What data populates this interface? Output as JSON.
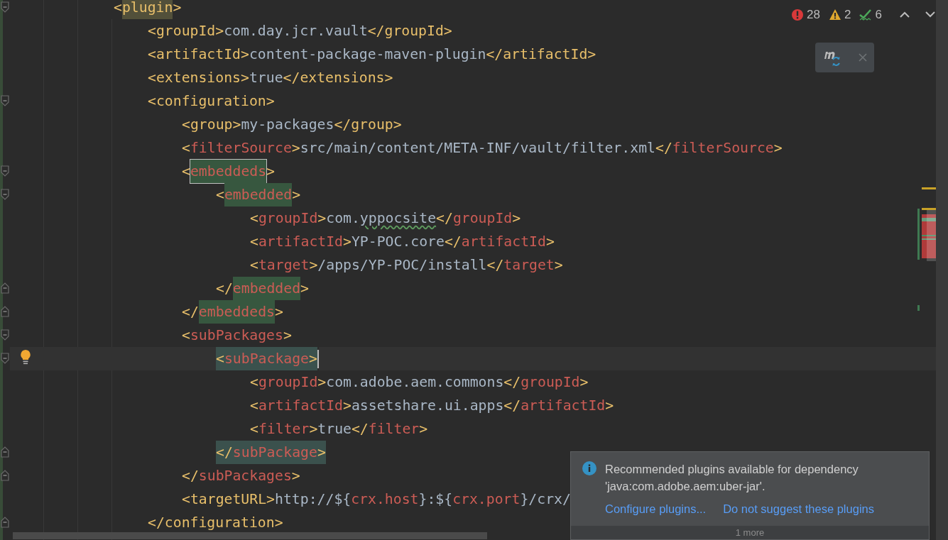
{
  "code": [
    {
      "line": {
        "tokens": [
          {
            "text": "<",
            "kind": "tag"
          },
          {
            "text": "plugin",
            "kind": "tag",
            "usage_highlight": true
          },
          {
            "text": ">",
            "kind": "tag"
          }
        ]
      },
      "children": [
        {
          "line": {
            "tokens": [
              {
                "text": "<groupId>",
                "kind": "tag"
              },
              {
                "text": "com.day.jcr.vault",
                "kind": "text"
              },
              {
                "text": "</groupId>",
                "kind": "tag"
              }
            ]
          }
        },
        {
          "line": {
            "tokens": [
              {
                "text": "<artifactId>",
                "kind": "tag"
              },
              {
                "text": "content-package-maven-plugin",
                "kind": "text"
              },
              {
                "text": "</artifactId>",
                "kind": "tag"
              }
            ]
          }
        },
        {
          "line": {
            "tokens": [
              {
                "text": "<extensions>",
                "kind": "tag"
              },
              {
                "text": "true",
                "kind": "text"
              },
              {
                "text": "</extensions>",
                "kind": "tag"
              }
            ]
          }
        },
        {
          "line": {
            "tokens": [
              {
                "text": "<configuration>",
                "kind": "tag"
              }
            ]
          },
          "children": [
            {
              "line": {
                "tokens": [
                  {
                    "text": "<group>",
                    "kind": "tag"
                  },
                  {
                    "text": "my-packages",
                    "kind": "text"
                  },
                  {
                    "text": "</group>",
                    "kind": "tag"
                  }
                ]
              }
            },
            {
              "line": {
                "tokens": [
                  {
                    "text": "<",
                    "kind": "tag"
                  },
                  {
                    "text": "filterSource",
                    "kind": "unknown"
                  },
                  {
                    "text": ">",
                    "kind": "tag"
                  },
                  {
                    "text": "src/main/content/META-INF/vault/filter.xml",
                    "kind": "text"
                  },
                  {
                    "text": "</",
                    "kind": "tag"
                  },
                  {
                    "text": "filterSource",
                    "kind": "unknown"
                  },
                  {
                    "text": ">",
                    "kind": "tag"
                  }
                ]
              }
            },
            {
              "line": {
                "tokens": [
                  {
                    "text": "<",
                    "kind": "tag"
                  },
                  {
                    "text": "embeddeds",
                    "kind": "unknown",
                    "brace_match": true,
                    "outlined": true
                  },
                  {
                    "text": ">",
                    "kind": "tag"
                  }
                ]
              },
              "children": [
                {
                  "line": {
                    "tokens": [
                      {
                        "text": "<",
                        "kind": "tag"
                      },
                      {
                        "text": "embedded",
                        "kind": "unknown",
                        "brace_match": true
                      },
                      {
                        "text": ">",
                        "kind": "tag"
                      }
                    ]
                  },
                  "children": [
                    {
                      "line": {
                        "tokens": [
                          {
                            "text": "<",
                            "kind": "tag"
                          },
                          {
                            "text": "groupId",
                            "kind": "unknown"
                          },
                          {
                            "text": ">",
                            "kind": "tag"
                          },
                          {
                            "text": "com.",
                            "kind": "text"
                          },
                          {
                            "text": "yppocsite",
                            "kind": "typo"
                          },
                          {
                            "text": "</",
                            "kind": "tag"
                          },
                          {
                            "text": "groupId",
                            "kind": "unknown"
                          },
                          {
                            "text": ">",
                            "kind": "tag"
                          }
                        ]
                      }
                    },
                    {
                      "line": {
                        "tokens": [
                          {
                            "text": "<",
                            "kind": "tag"
                          },
                          {
                            "text": "artifactId",
                            "kind": "unknown"
                          },
                          {
                            "text": ">",
                            "kind": "tag"
                          },
                          {
                            "text": "YP-POC.core",
                            "kind": "text"
                          },
                          {
                            "text": "</",
                            "kind": "tag"
                          },
                          {
                            "text": "artifactId",
                            "kind": "unknown"
                          },
                          {
                            "text": ">",
                            "kind": "tag"
                          }
                        ]
                      }
                    },
                    {
                      "line": {
                        "tokens": [
                          {
                            "text": "<",
                            "kind": "tag"
                          },
                          {
                            "text": "target",
                            "kind": "unknown"
                          },
                          {
                            "text": ">",
                            "kind": "tag"
                          },
                          {
                            "text": "/apps/YP-POC/install",
                            "kind": "text"
                          },
                          {
                            "text": "</",
                            "kind": "tag"
                          },
                          {
                            "text": "target",
                            "kind": "unknown"
                          },
                          {
                            "text": ">",
                            "kind": "tag"
                          }
                        ]
                      }
                    }
                  ],
                  "end": {
                    "tokens": [
                      {
                        "text": "</",
                        "kind": "tag"
                      },
                      {
                        "text": "embedded",
                        "kind": "unknown",
                        "brace_match": true
                      },
                      {
                        "text": ">",
                        "kind": "tag"
                      }
                    ]
                  }
                }
              ],
              "end": {
                "tokens": [
                  {
                    "text": "</",
                    "kind": "tag"
                  },
                  {
                    "text": "embeddeds",
                    "kind": "unknown",
                    "brace_match": true
                  },
                  {
                    "text": ">",
                    "kind": "tag"
                  }
                ]
              }
            },
            {
              "line": {
                "tokens": [
                  {
                    "text": "<",
                    "kind": "tag"
                  },
                  {
                    "text": "subPackages",
                    "kind": "unknown"
                  },
                  {
                    "text": ">",
                    "kind": "tag"
                  }
                ]
              },
              "children": [
                {
                  "line": {
                    "current": true,
                    "intention": true,
                    "caret": true,
                    "tokens": [
                      {
                        "text": "<",
                        "kind": "tag",
                        "pair_highlight": true
                      },
                      {
                        "text": "subPackage",
                        "kind": "unknown",
                        "pair_highlight": true
                      },
                      {
                        "text": ">",
                        "kind": "tag",
                        "pair_highlight": true
                      }
                    ]
                  },
                  "children": [
                    {
                      "line": {
                        "tokens": [
                          {
                            "text": "<",
                            "kind": "tag"
                          },
                          {
                            "text": "groupId",
                            "kind": "unknown"
                          },
                          {
                            "text": ">",
                            "kind": "tag"
                          },
                          {
                            "text": "com.adobe.aem.commons",
                            "kind": "text"
                          },
                          {
                            "text": "</",
                            "kind": "tag"
                          },
                          {
                            "text": "groupId",
                            "kind": "unknown"
                          },
                          {
                            "text": ">",
                            "kind": "tag"
                          }
                        ]
                      }
                    },
                    {
                      "line": {
                        "tokens": [
                          {
                            "text": "<",
                            "kind": "tag"
                          },
                          {
                            "text": "artifactId",
                            "kind": "unknown"
                          },
                          {
                            "text": ">",
                            "kind": "tag"
                          },
                          {
                            "text": "assetshare.ui.apps",
                            "kind": "text"
                          },
                          {
                            "text": "</",
                            "kind": "tag"
                          },
                          {
                            "text": "artifactId",
                            "kind": "unknown"
                          },
                          {
                            "text": ">",
                            "kind": "tag"
                          }
                        ]
                      }
                    },
                    {
                      "line": {
                        "tokens": [
                          {
                            "text": "<",
                            "kind": "tag"
                          },
                          {
                            "text": "filter",
                            "kind": "unknown"
                          },
                          {
                            "text": ">",
                            "kind": "tag"
                          },
                          {
                            "text": "true",
                            "kind": "text"
                          },
                          {
                            "text": "</",
                            "kind": "tag"
                          },
                          {
                            "text": "filter",
                            "kind": "unknown"
                          },
                          {
                            "text": ">",
                            "kind": "tag"
                          }
                        ]
                      }
                    }
                  ],
                  "end": {
                    "tokens": [
                      {
                        "text": "</",
                        "kind": "tag",
                        "pair_highlight": true
                      },
                      {
                        "text": "subPackage",
                        "kind": "unknown",
                        "pair_highlight": true
                      },
                      {
                        "text": ">",
                        "kind": "tag",
                        "pair_highlight": true
                      }
                    ]
                  }
                }
              ],
              "end": {
                "tokens": [
                  {
                    "text": "</",
                    "kind": "tag"
                  },
                  {
                    "text": "subPackages",
                    "kind": "unknown"
                  },
                  {
                    "text": ">",
                    "kind": "tag"
                  }
                ]
              }
            },
            {
              "line": {
                "tokens": [
                  {
                    "text": "<targetURL>",
                    "kind": "tag"
                  },
                  {
                    "text": "http://${",
                    "kind": "text"
                  },
                  {
                    "text": "crx.host",
                    "kind": "unknown"
                  },
                  {
                    "text": "}:${",
                    "kind": "text"
                  },
                  {
                    "text": "crx.port",
                    "kind": "unknown"
                  },
                  {
                    "text": "}/crx/",
                    "kind": "text"
                  }
                ]
              }
            }
          ],
          "end": {
            "tokens": [
              {
                "text": "</configuration>",
                "kind": "tag"
              }
            ]
          }
        }
      ]
    }
  ],
  "inspections": [
    {
      "kind": "error",
      "count": "28"
    },
    {
      "kind": "warning",
      "count": "2"
    },
    {
      "kind": "typo",
      "count": "6"
    }
  ],
  "notification": {
    "message": "Recommended plugins available for dependency 'java:com.adobe.aem:uber-jar'.",
    "actions": [
      "Configure plugins...",
      "Do not suggest these plugins"
    ],
    "more": "1 more"
  }
}
